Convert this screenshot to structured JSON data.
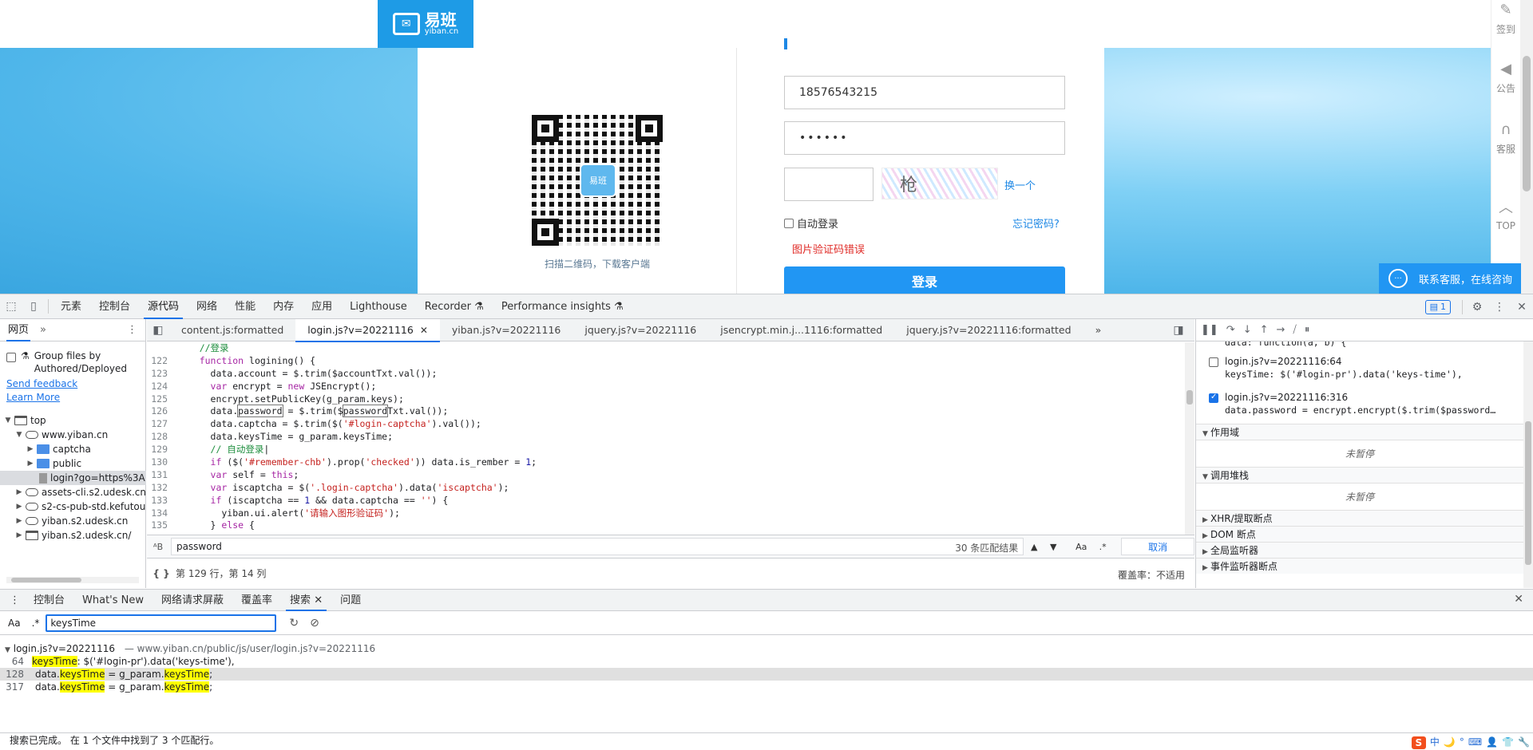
{
  "site": {
    "logo_cn": "易班",
    "logo_en": "yiban.cn",
    "qr_badge": "易班",
    "qr_caption": "扫描二维码，下载客户端",
    "phone_value": "18576543215",
    "password_mask": "••••••",
    "captcha_glyph": "枪",
    "captcha_refresh": "换一个",
    "remember_label": "自动登录",
    "forgot_label": "忘记密码?",
    "captcha_error": "图片验证码错误",
    "login_button": "登录",
    "rail": [
      {
        "icon": "pencil-icon",
        "glyph": "✎",
        "label": "签到"
      },
      {
        "icon": "megaphone-icon",
        "glyph": "◀",
        "label": "公告"
      },
      {
        "icon": "headset-icon",
        "glyph": "∩",
        "label": "客服"
      },
      {
        "icon": "top-arrow-icon",
        "glyph": "︿",
        "label": "TOP"
      }
    ],
    "support_button": "联系客服，在线咨询",
    "support_icon_glyph": "···",
    "colors": {
      "brand": "#1e9be6",
      "button": "#2196f3",
      "error": "#e02b27"
    }
  },
  "devtools": {
    "tabs": [
      "元素",
      "控制台",
      "源代码",
      "网络",
      "性能",
      "内存",
      "应用",
      "Lighthouse",
      "Recorder ⚗",
      "Performance insights ⚗"
    ],
    "active_tab": "源代码",
    "issues_count": "1",
    "navigator": {
      "tab": "网页",
      "more": "»",
      "group_label": "Group files by Authored/Deployed",
      "group_icon": "⚗",
      "send_feedback": "Send feedback",
      "learn_more": "Learn More",
      "tree": [
        {
          "label": "top",
          "icon": "frame",
          "indent": 0,
          "arrow": "▼"
        },
        {
          "label": "www.yiban.cn",
          "icon": "cloud",
          "indent": 1,
          "arrow": "▼"
        },
        {
          "label": "captcha",
          "icon": "folder",
          "indent": 2,
          "arrow": "▶"
        },
        {
          "label": "public",
          "icon": "folder",
          "indent": 2,
          "arrow": "▶"
        },
        {
          "label": "login?go=https%3A",
          "icon": "file",
          "indent": 2,
          "arrow": "",
          "selected": true
        },
        {
          "label": "assets-cli.s2.udesk.cn",
          "icon": "cloud",
          "indent": 1,
          "arrow": "▶"
        },
        {
          "label": "s2-cs-pub-std.kefutou",
          "icon": "cloud",
          "indent": 1,
          "arrow": "▶"
        },
        {
          "label": "yiban.s2.udesk.cn",
          "icon": "cloud",
          "indent": 1,
          "arrow": "▶"
        },
        {
          "label": "yiban.s2.udesk.cn/",
          "icon": "frame",
          "indent": 1,
          "arrow": "▶"
        }
      ]
    },
    "file_tabs": [
      {
        "label": "content.js:formatted",
        "active": false
      },
      {
        "label": "login.js?v=20221116",
        "active": true
      },
      {
        "label": "yiban.js?v=20221116",
        "active": false
      },
      {
        "label": "jquery.js?v=20221116",
        "active": false
      },
      {
        "label": "jsencrypt.min.j...1116:formatted",
        "active": false
      },
      {
        "label": "jquery.js?v=20221116:formatted",
        "active": false
      }
    ],
    "file_tabs_more": "»",
    "code_lines": [
      {
        "n": "",
        "html": "    <span class=\"c-cmt\">//登录</span>"
      },
      {
        "n": "122",
        "html": "    <span class=\"c-kw\">function</span> logining() {"
      },
      {
        "n": "123",
        "html": "      data.account = $.trim($accountTxt.val());"
      },
      {
        "n": "124",
        "html": "      <span class=\"c-kw\">var</span> encrypt = <span class=\"c-kw\">new</span> JSEncrypt();"
      },
      {
        "n": "125",
        "html": "      encrypt.setPublicKey(g_param.keys);"
      },
      {
        "n": "126",
        "html": "      data.<span class=\"c-hl\">password</span> = $.trim($<span class=\"c-hl\">password</span>Txt.val());"
      },
      {
        "n": "127",
        "html": "      data.captcha = $.trim($(<span class=\"c-str\">'#login-captcha'</span>).val());"
      },
      {
        "n": "128",
        "html": "      data.keysTime = g_param.keysTime;"
      },
      {
        "n": "129",
        "html": "      <span class=\"c-cmt\">// 自动登录</span>|"
      },
      {
        "n": "130",
        "html": "      <span class=\"c-kw\">if</span> ($(<span class=\"c-str\">'#remember-chb'</span>).prop(<span class=\"c-str\">'checked'</span>)) data.is_rember = <span class=\"c-num\">1</span>;"
      },
      {
        "n": "131",
        "html": "      <span class=\"c-kw\">var</span> self = <span class=\"c-kw\">this</span>;"
      },
      {
        "n": "132",
        "html": "      <span class=\"c-kw\">var</span> iscaptcha = $(<span class=\"c-str\">'.login-captcha'</span>).data(<span class=\"c-str\">'iscaptcha'</span>);"
      },
      {
        "n": "133",
        "html": "      <span class=\"c-kw\">if</span> (iscaptcha == <span class=\"c-num\">1</span> &amp;&amp; data.captcha == <span class=\"c-str\">''</span>) {"
      },
      {
        "n": "134",
        "html": "        yiban.ui.alert(<span class=\"c-str\">'请输入图形验证码'</span>);"
      },
      {
        "n": "135",
        "html": "      } <span class=\"c-kw\">else</span> {"
      }
    ],
    "find": {
      "query": "password",
      "count": "30 条匹配结果",
      "cancel": "取消",
      "case_toggle": "Aa",
      "regex_toggle": ".*"
    },
    "status": {
      "braces": "{ }",
      "position": "第 129 行，第 14 列",
      "coverage": "覆盖率：不适用"
    },
    "debug": {
      "partial_line": "data: function(a, b) {",
      "breakpoints": [
        {
          "file": "login.js?v=20221116:64",
          "code": "keysTime: $('#login-pr').data('keys-time'),",
          "checked": false
        },
        {
          "file": "login.js?v=20221116:316",
          "code": "data.password = encrypt.encrypt($.trim($password…",
          "checked": true
        }
      ],
      "scope_head": "作用域",
      "scope_body": "未暂停",
      "callstack_head": "调用堆栈",
      "callstack_body": "未暂停",
      "sections": [
        "XHR/提取断点",
        "DOM 断点",
        "全局监听器",
        "事件监听器断点"
      ]
    },
    "drawer": {
      "tabs": [
        "控制台",
        "What's New",
        "网络请求屏蔽",
        "覆盖率",
        "搜索",
        "问题"
      ],
      "active_tab": "搜索",
      "search_query": "keysTime",
      "case_toggle": "Aa",
      "regex_toggle": ".*",
      "result_file": "login.js?v=20221116",
      "result_path": "— www.yiban.cn/public/js/user/login.js?v=20221116",
      "results": [
        {
          "n": "64",
          "pre": "",
          "m1": "keysTime",
          "mid": ": $('#login-pr').data('keys-time'),",
          "m2": "",
          "post": "",
          "selected": false
        },
        {
          "n": "128",
          "pre": "data.",
          "m1": "keysTime",
          "mid": " = g_param.",
          "m2": "keysTime",
          "post": ";",
          "selected": true
        },
        {
          "n": "317",
          "pre": "data.",
          "m1": "keysTime",
          "mid": " = g_param.",
          "m2": "keysTime",
          "post": ";",
          "selected": false
        }
      ],
      "status_text": "搜索已完成。  在 1 个文件中找到了 3 个匹配行。",
      "tray": [
        "中",
        "🌙",
        "°",
        "⌨",
        "👤",
        "👕",
        "🔧"
      ],
      "tray_logo": "S"
    }
  }
}
